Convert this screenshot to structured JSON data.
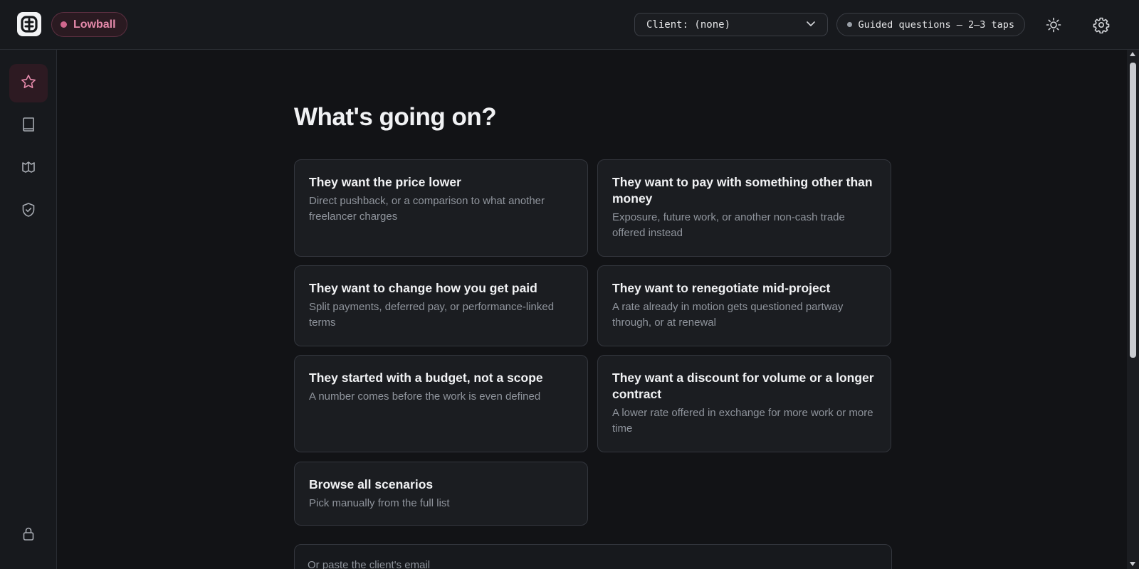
{
  "header": {
    "logo_icon": "app-logo-icon",
    "mode_label": "Lowball",
    "client_select_value": "Client: (none)",
    "guided_label": "Guided questions — 2–3 taps",
    "theme_icon": "sun-icon",
    "settings_icon": "gear-icon"
  },
  "sidebar": {
    "items": [
      {
        "icon": "star-icon",
        "active": true
      },
      {
        "icon": "book-icon",
        "active": false
      },
      {
        "icon": "open-book-icon",
        "active": false
      },
      {
        "icon": "shield-check-icon",
        "active": false
      }
    ],
    "bottom_icon": "lock-icon"
  },
  "main": {
    "title": "What's going on?",
    "scenarios": [
      {
        "title": "They want the price lower",
        "desc": "Direct pushback, or a comparison to what another freelancer charges"
      },
      {
        "title": "They want to pay with something other than money",
        "desc": "Exposure, future work, or another non-cash trade offered instead"
      },
      {
        "title": "They want to change how you get paid",
        "desc": "Split payments, deferred pay, or performance-linked terms"
      },
      {
        "title": "They want to renegotiate mid-project",
        "desc": "A rate already in motion gets questioned partway through, or at renewal"
      },
      {
        "title": "They started with a budget, not a scope",
        "desc": "A number comes before the work is even defined"
      },
      {
        "title": "They want a discount for volume or a longer contract",
        "desc": "A lower rate offered in exchange for more work or more time"
      },
      {
        "title": "Browse all scenarios",
        "desc": "Pick manually from the full list"
      }
    ],
    "paste_placeholder": "Or paste the client's email"
  },
  "colors": {
    "accent": "#e58aab",
    "background": "#121316",
    "card": "#1b1d21"
  }
}
